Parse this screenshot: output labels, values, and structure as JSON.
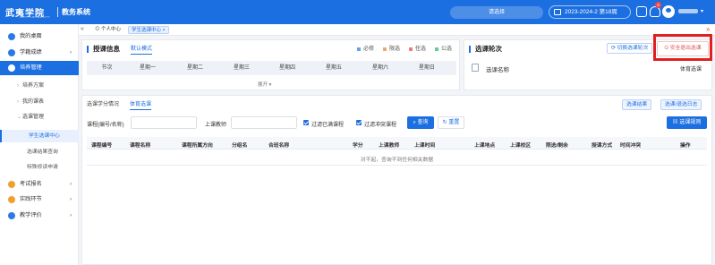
{
  "header": {
    "logo_text": "武夷学院",
    "logo_sub": "WUYI UNIVERSITY",
    "system_title": "教务系统",
    "search_placeholder": "请选择",
    "term": "2023-2024-2 第18周",
    "notification_count": "4"
  },
  "tabs": [
    {
      "label": "个人中心"
    },
    {
      "label": "学生选课中心 ×"
    }
  ],
  "sidebar": {
    "items": [
      {
        "label": "我的桌面"
      },
      {
        "label": "学籍成绩"
      },
      {
        "label": "培养管理"
      },
      {
        "label": "培养方案"
      },
      {
        "label": "我的课表"
      },
      {
        "label": "选课管理"
      },
      {
        "label": "学生选课中心"
      },
      {
        "label": "选课结果查询"
      },
      {
        "label": "特殊修读申请"
      },
      {
        "label": "考试报名"
      },
      {
        "label": "实践环节"
      },
      {
        "label": "教学评价"
      }
    ]
  },
  "schedule_card": {
    "title": "授课信息",
    "mode_tab": "默认模式",
    "legend": [
      "必修",
      "限选",
      "任选",
      "公选"
    ],
    "legend_colors": [
      "#6aa0f0",
      "#f0a870",
      "#f07c7c",
      "#5fcf9a"
    ],
    "columns": [
      "节次",
      "星期一",
      "星期二",
      "星期三",
      "星期四",
      "星期五",
      "星期六",
      "星期日"
    ],
    "expand_label": "展开"
  },
  "round_card": {
    "title": "选课轮次",
    "switch_round": "切换选课轮次",
    "safe_exit": "安全退出选课",
    "course_name_label": "选课名称",
    "course_name_value": "体育选课"
  },
  "section": {
    "tabs": [
      "选课学分情况",
      "体育选课"
    ],
    "result_btn": "选课结果",
    "log_btn": "选课/退选日志",
    "course_label": "课程(编号/名称)",
    "teacher_label": "上课教师",
    "filter_full": "过滤已满课程",
    "filter_conflict": "过滤冲突课程",
    "query_btn": "查询",
    "reset_btn": "重置",
    "rules_btn": "选课规则"
  },
  "table": {
    "headers": [
      "课程编号",
      "课程名称",
      "课程所属方向",
      "分组名",
      "合班名称",
      "学分",
      "上课教师",
      "上课时间",
      "上课地点",
      "上课校区",
      "限选/剩余",
      "授课方式",
      "时间冲突",
      "操作"
    ],
    "empty_text": "对不起，查询不到任何相关数据"
  }
}
